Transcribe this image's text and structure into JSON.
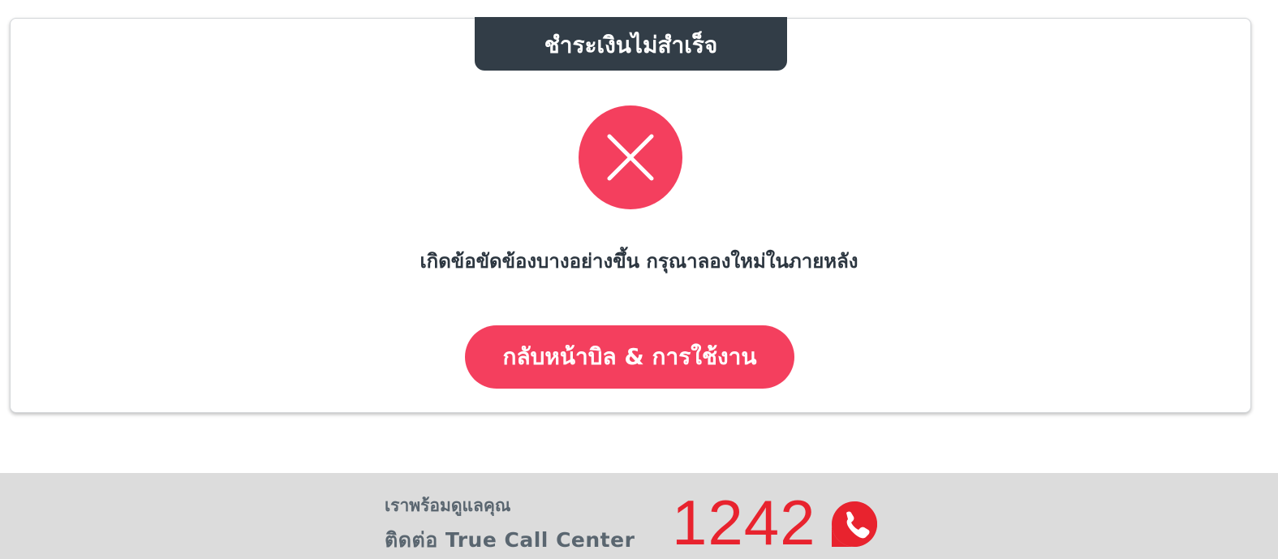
{
  "status": {
    "title": "ชำระเงินไม่สำเร็จ",
    "icon": "close-icon",
    "message": "เกิดข้อขัดข้องบางอย่างขึ้น กรุณาลองใหม่ในภายหลัง"
  },
  "actions": {
    "back_label": "กลับหน้าบิล & การใช้งาน"
  },
  "footer": {
    "subtitle": "เราพร้อมดูแลคุณ",
    "contact_text": "ติดต่อ True Call Center",
    "call_number": "1242",
    "phone_icon": "phone-icon"
  },
  "colors": {
    "accent": "#f43f5e",
    "title_bar": "#323d47",
    "call_number": "#e8232e",
    "footer_bg": "#dcdcdc"
  }
}
